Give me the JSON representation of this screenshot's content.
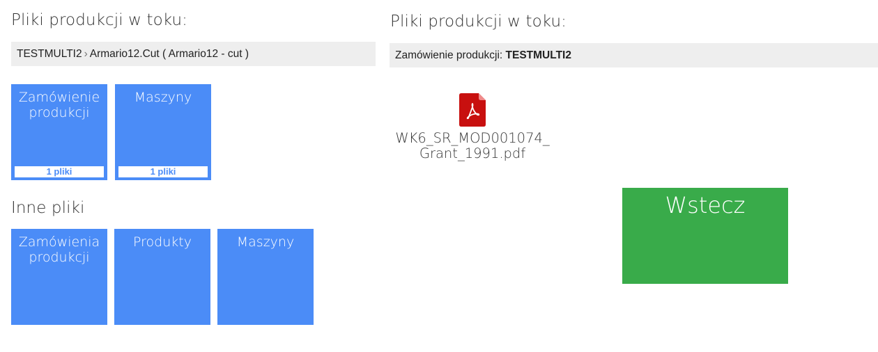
{
  "left": {
    "heading": "Pliki produkcji w toku:",
    "breadcrumb": {
      "item1": "TESTMULTI2",
      "separator": "›",
      "item2": "Armario12.Cut ( Armario12 - cut )"
    },
    "tiles": [
      {
        "label": "Zamówienie produkcji",
        "count": "1 pliki"
      },
      {
        "label": "Maszyny",
        "count": "1 pliki"
      }
    ],
    "other_heading": "Inne pliki",
    "other_tiles": [
      {
        "label": "Zamówienia produkcji"
      },
      {
        "label": "Produkty"
      },
      {
        "label": "Maszyny"
      }
    ]
  },
  "right": {
    "heading": "Pliki produkcji w toku:",
    "order_bar": {
      "label": "Zamówienie produkcji:",
      "value": "TESTMULTI2"
    },
    "file": {
      "icon": "pdf-file-icon",
      "name_line1": "WK6_SR_MOD001074_",
      "name_line2": "Grant_1991.pdf"
    },
    "back_button": "Wstecz"
  },
  "colors": {
    "tile_blue": "#4b8cf7",
    "back_green": "#39ab4a",
    "bar_gray": "#eeeeee",
    "pdf_red": "#c8100f"
  }
}
